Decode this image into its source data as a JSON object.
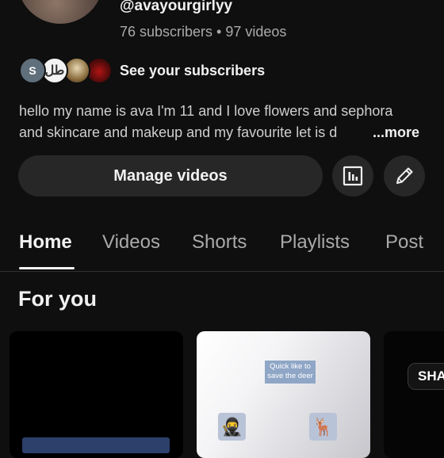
{
  "channel": {
    "handle": "@avayourgirlyy",
    "stats": "76 subscribers • 97 videos",
    "see_subscribers": "See your subscribers",
    "subscriber_avatar_initial": "S",
    "subscriber_avatar_2_text": "طل",
    "description_line1": "hello  my name is ava I'm 11 and I love flowers and sephora",
    "description_line2": "and skincare and makeup  and my favourite  let is d",
    "more_label": "...more"
  },
  "actions": {
    "manage_videos": "Manage videos",
    "analytics_icon": "analytics-icon",
    "edit_icon": "pencil-icon"
  },
  "tabs": [
    {
      "label": "Home",
      "active": true
    },
    {
      "label": "Videos",
      "active": false
    },
    {
      "label": "Shorts",
      "active": false
    },
    {
      "label": "Playlists",
      "active": false
    },
    {
      "label": "Post",
      "active": false
    }
  ],
  "section": {
    "title": "For you"
  },
  "cards": [
    {
      "caption": ""
    },
    {
      "caption": "Quick  like to save the deer",
      "emoji_left": "🥷",
      "emoji_right": "🦌"
    },
    {
      "caption": "SHA"
    }
  ],
  "colors": {
    "background": "#0f0f0f",
    "button_bg": "#272727",
    "text_primary": "#f1f1f1",
    "text_secondary": "#aaaaaa"
  }
}
